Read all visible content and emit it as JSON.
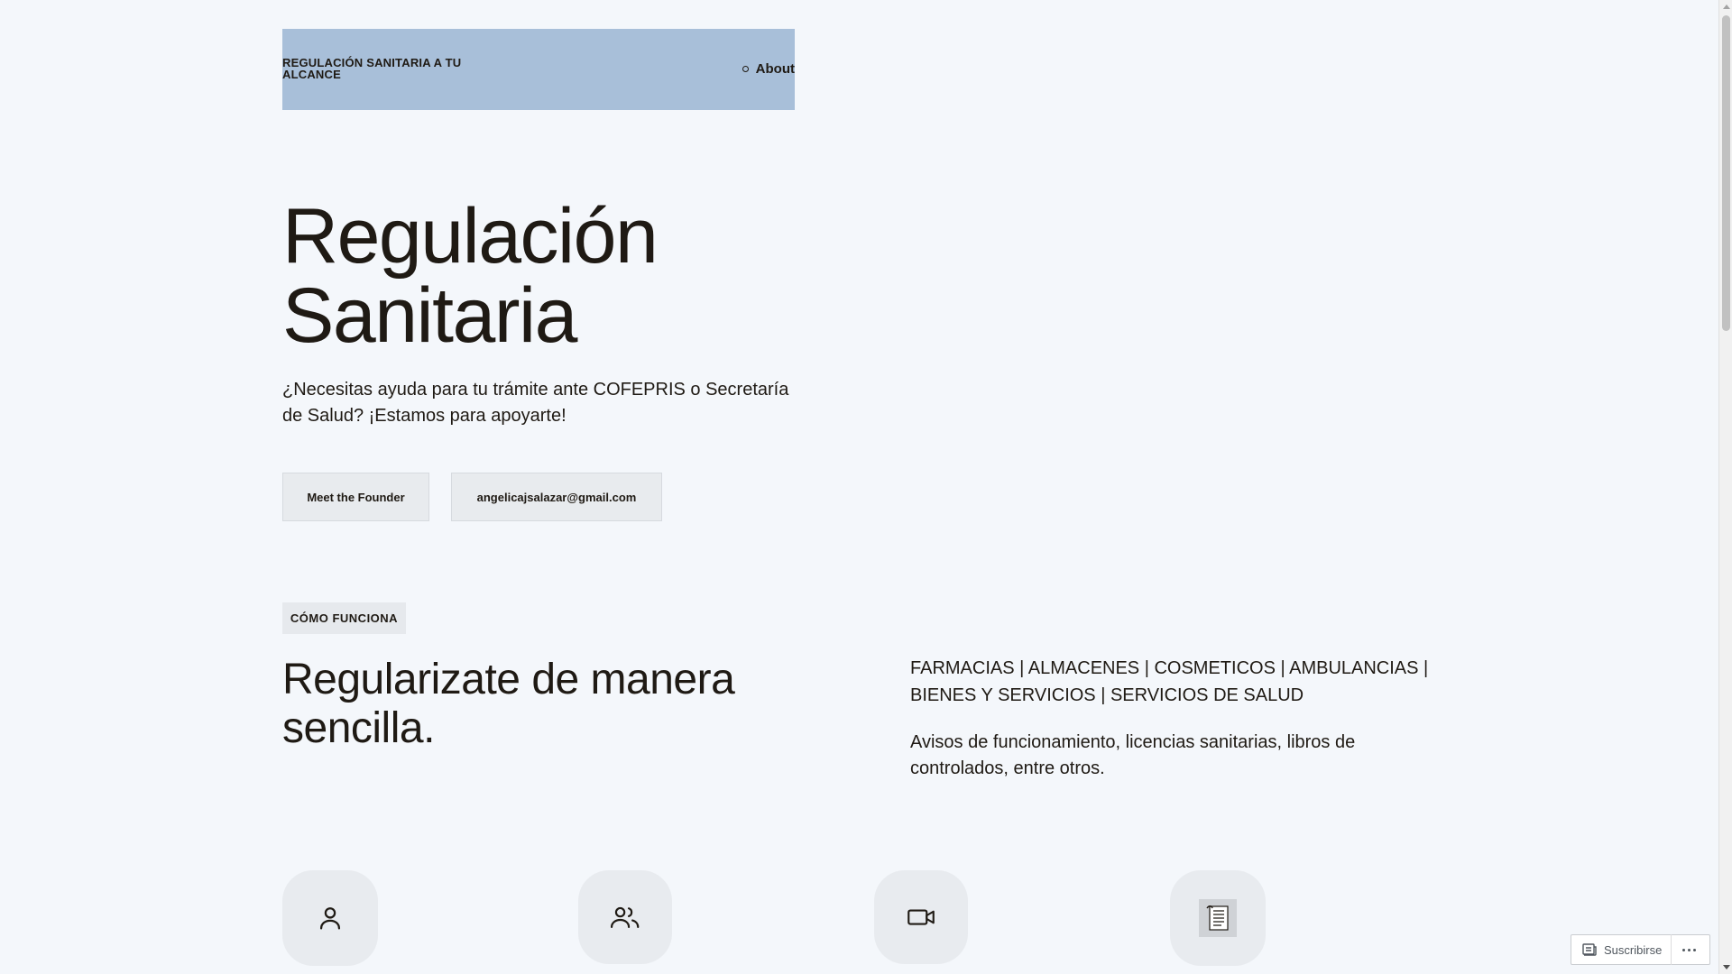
{
  "header": {
    "site_title": "REGULACIÓN SANITARIA A TU ALCANCE",
    "nav": [
      {
        "label": "About"
      }
    ]
  },
  "hero": {
    "title_line1": "Regulación",
    "title_line2": "Sanitaria",
    "subtitle": "¿Necesitas ayuda para tu trámite ante COFEPRIS o Secretaría de Salud? ¡Estamos para apoyarte!",
    "buttons": {
      "founder": "Meet the Founder",
      "email": "angelicajsalazar@gmail.com"
    }
  },
  "how_it_works": {
    "badge": "CÓMO FUNCIONA",
    "title": "Regularizate de manera sencilla.",
    "desc1": "FARMACIAS | ALMACENES | COSMETICOS | AMBULANCIAS | BIENES Y SERVICIOS | SERVICIOS DE SALUD",
    "desc2": "Avisos de funcionamiento, licencias sanitarias, libros de controlados, entre otros."
  },
  "features": [
    {
      "icon": "user-icon"
    },
    {
      "icon": "users-icon"
    },
    {
      "icon": "video-icon"
    },
    {
      "icon": "document-icon"
    }
  ],
  "subscribe": {
    "label": "Suscribirse"
  },
  "colors": {
    "background": "#f4f7fb",
    "header_bg": "#a8bfd9",
    "text": "#1f1a14",
    "button_bg": "#e8ebee"
  }
}
